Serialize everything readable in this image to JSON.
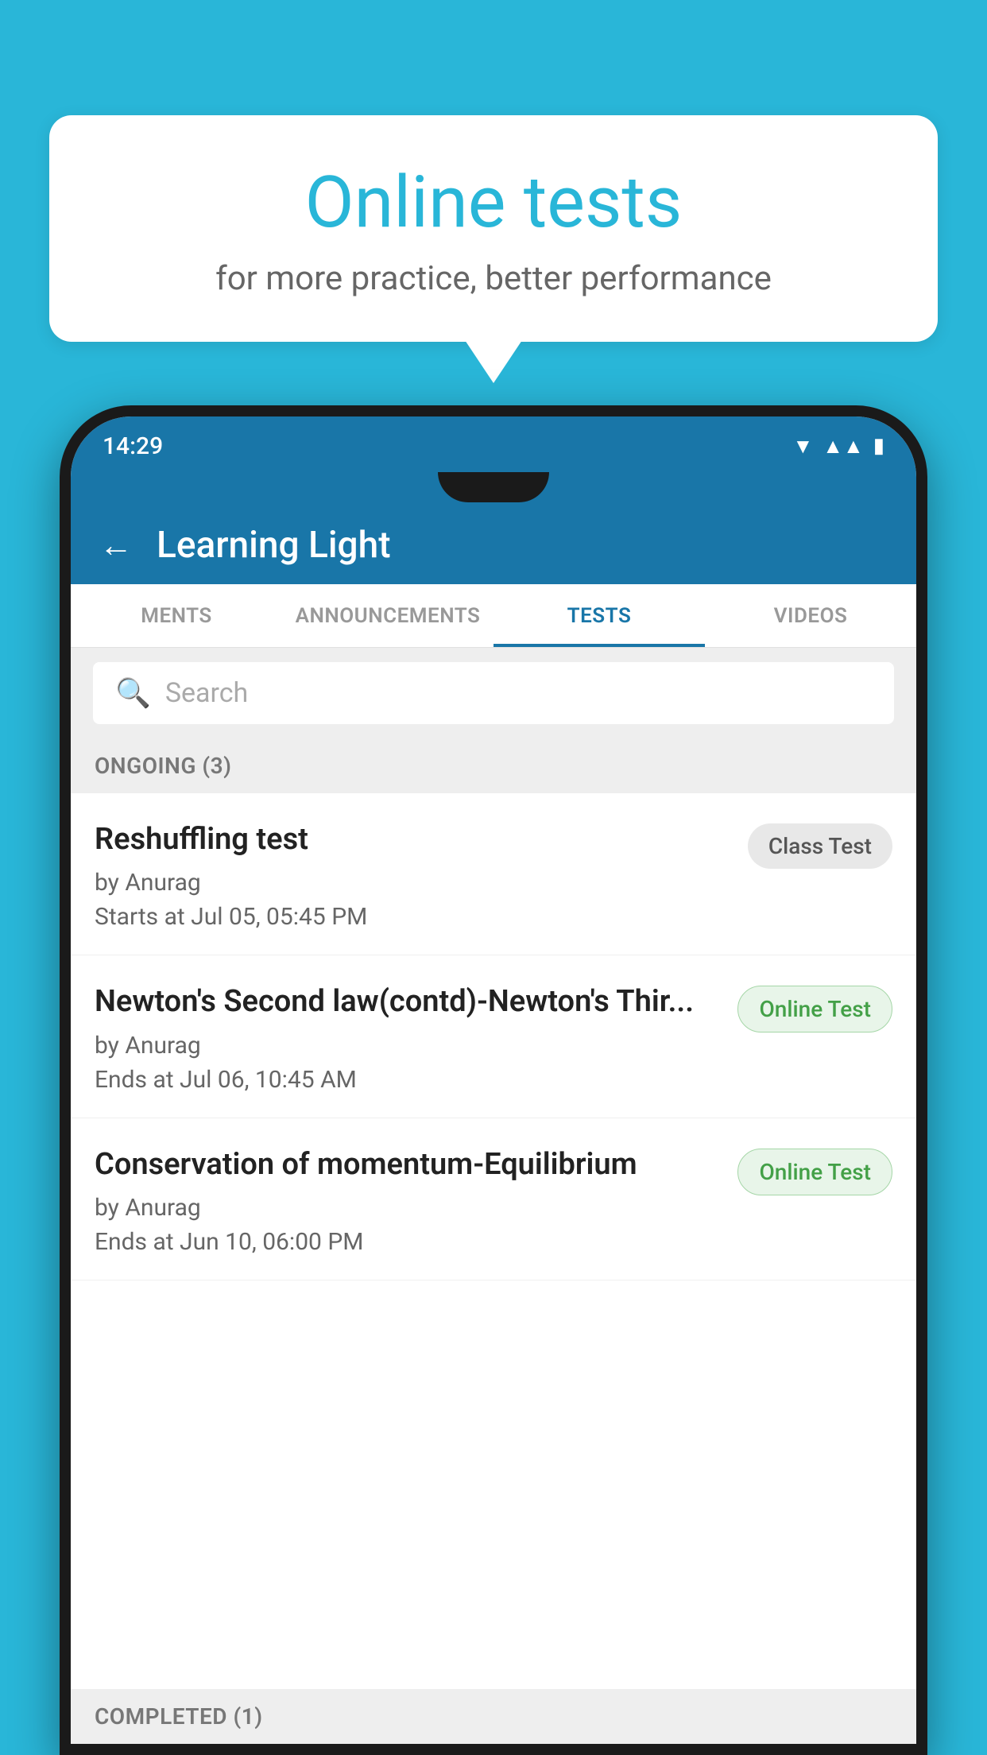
{
  "background_color": "#29B6D8",
  "speech_bubble": {
    "title": "Online tests",
    "subtitle": "for more practice, better performance"
  },
  "status_bar": {
    "time": "14:29",
    "icons": [
      "wifi",
      "signal",
      "battery"
    ]
  },
  "app_bar": {
    "title": "Learning Light",
    "back_label": "←"
  },
  "tabs": [
    {
      "label": "MENTS",
      "active": false
    },
    {
      "label": "ANNOUNCEMENTS",
      "active": false
    },
    {
      "label": "TESTS",
      "active": true
    },
    {
      "label": "VIDEOS",
      "active": false
    }
  ],
  "search": {
    "placeholder": "Search"
  },
  "ongoing_section": {
    "label": "ONGOING (3)"
  },
  "tests": [
    {
      "name": "Reshuffling test",
      "author": "by Anurag",
      "time": "Starts at  Jul 05, 05:45 PM",
      "badge": "Class Test",
      "badge_type": "class"
    },
    {
      "name": "Newton's Second law(contd)-Newton's Thir...",
      "author": "by Anurag",
      "time": "Ends at  Jul 06, 10:45 AM",
      "badge": "Online Test",
      "badge_type": "online"
    },
    {
      "name": "Conservation of momentum-Equilibrium",
      "author": "by Anurag",
      "time": "Ends at  Jun 10, 06:00 PM",
      "badge": "Online Test",
      "badge_type": "online"
    }
  ],
  "completed_section": {
    "label": "COMPLETED (1)"
  }
}
